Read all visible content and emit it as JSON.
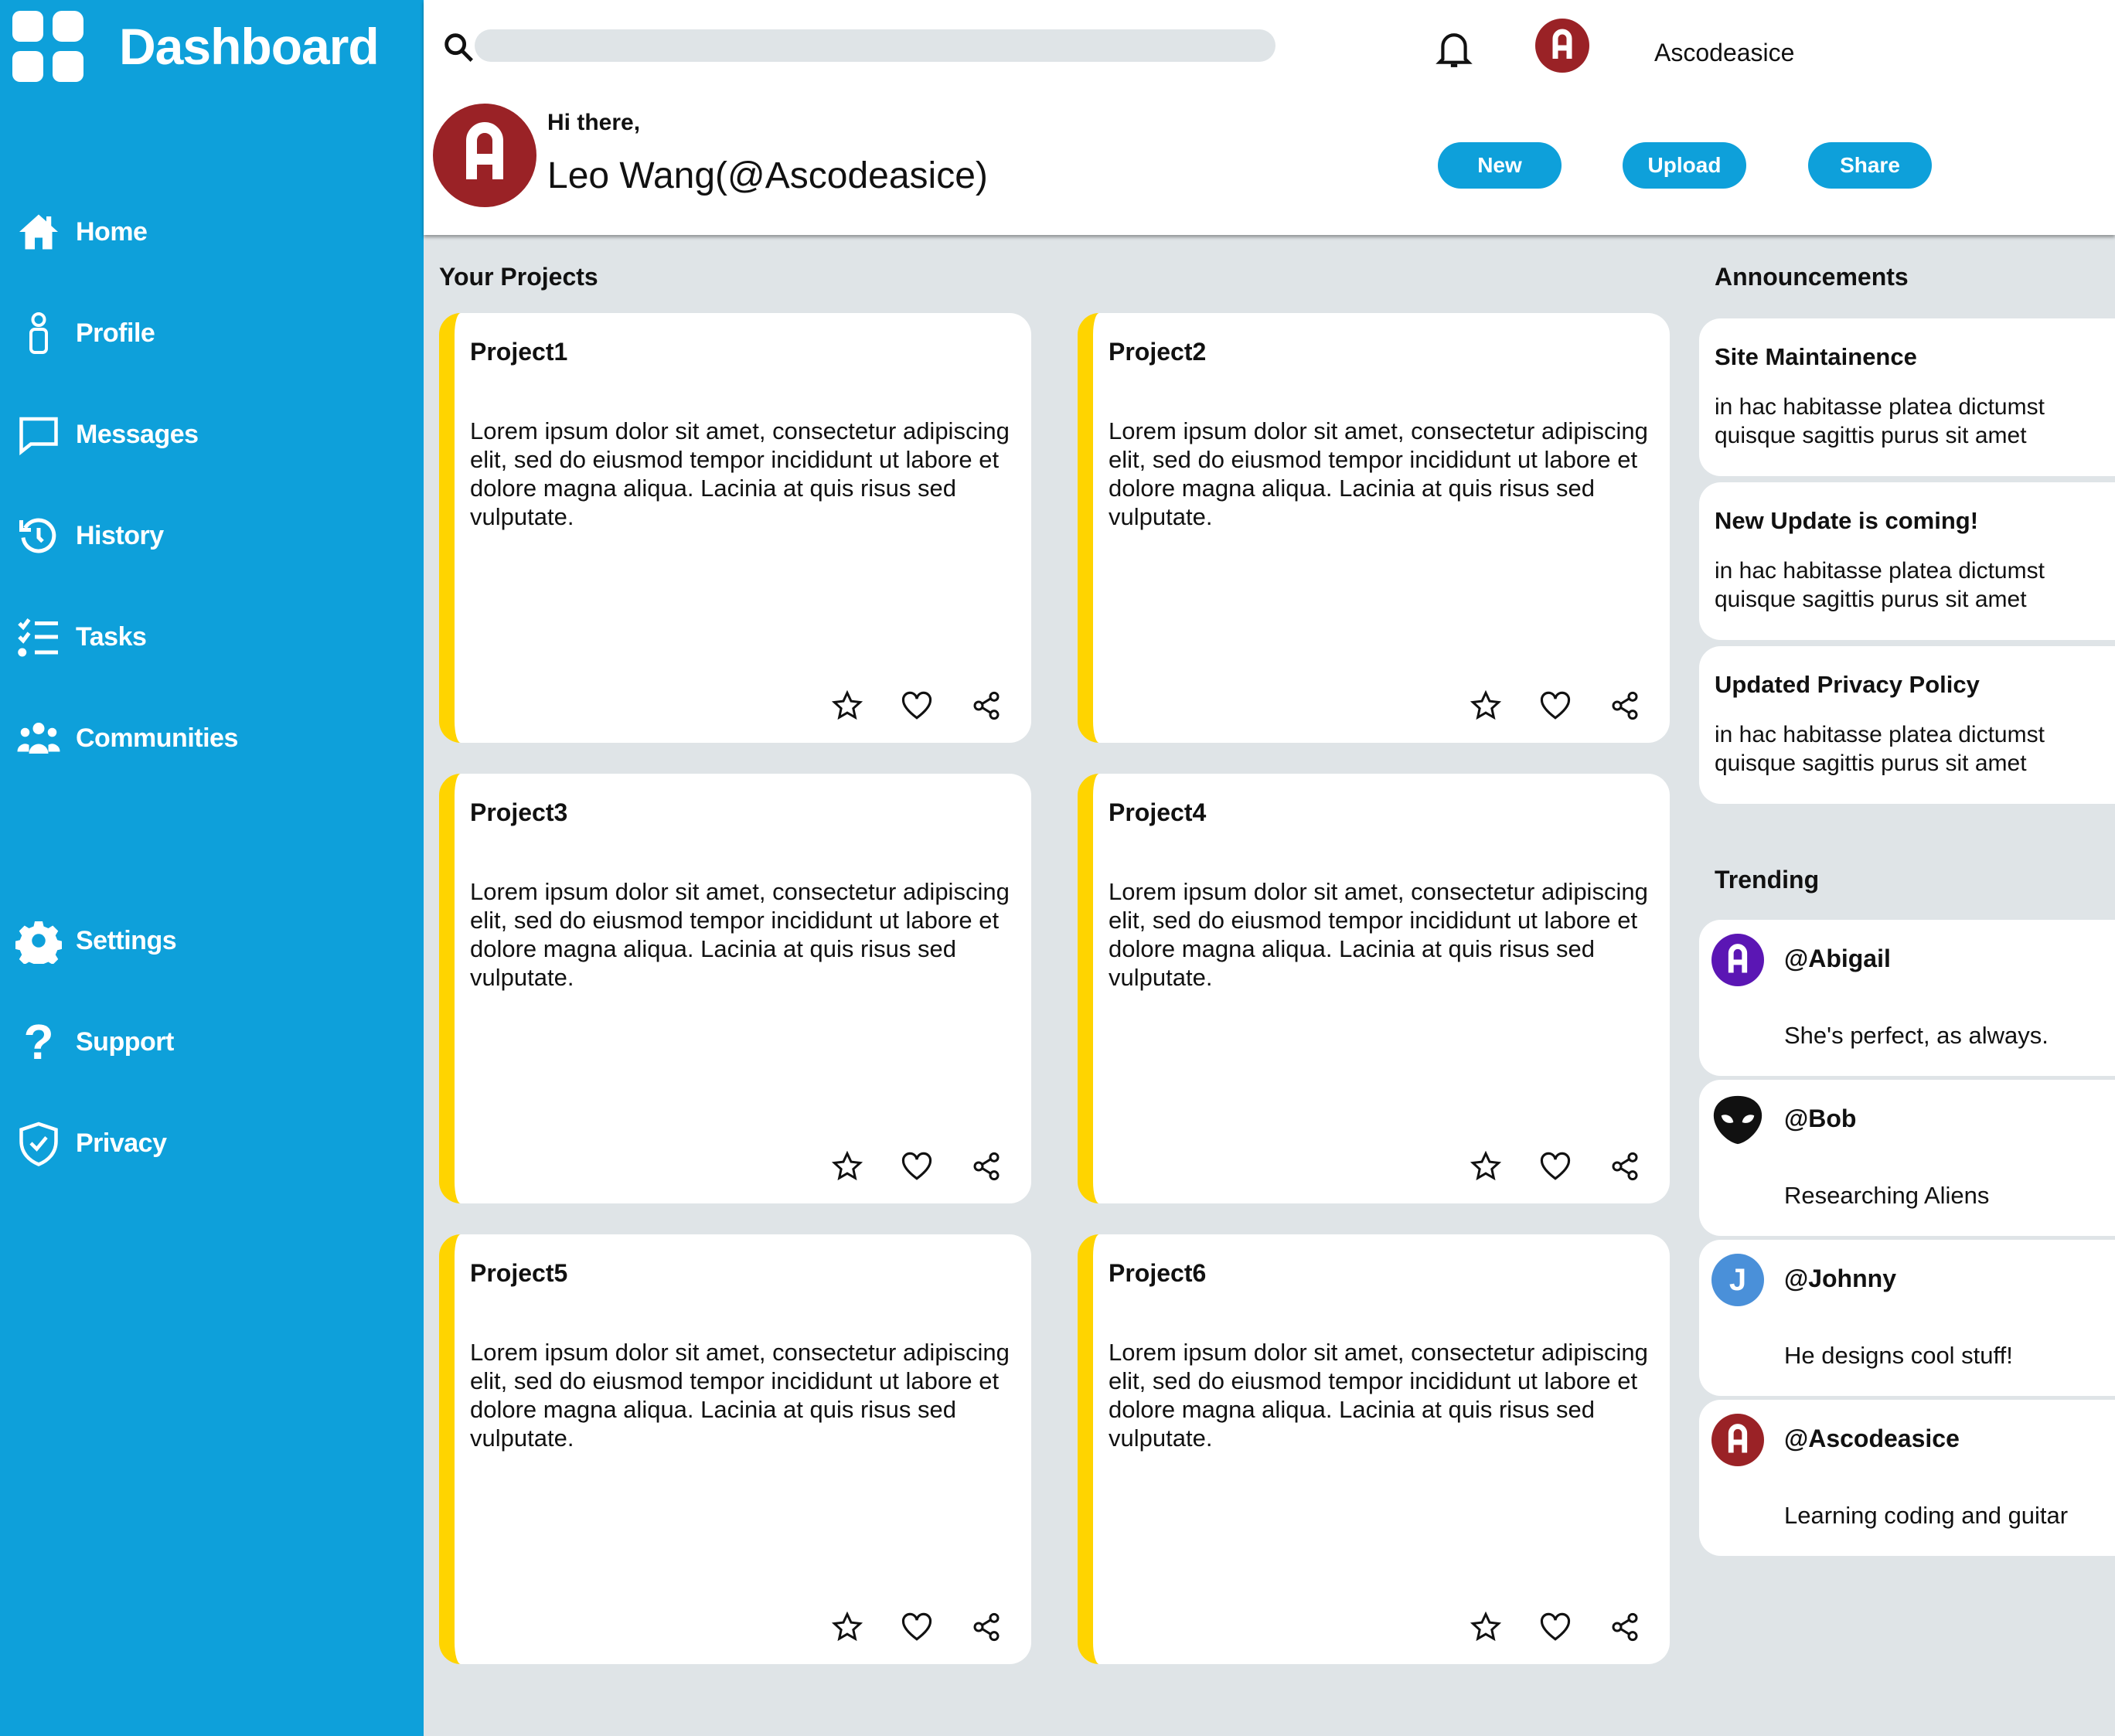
{
  "sidebar": {
    "title": "Dashboard",
    "items": [
      {
        "label": "Home",
        "icon": "home-icon"
      },
      {
        "label": "Profile",
        "icon": "person-icon"
      },
      {
        "label": "Messages",
        "icon": "chat-icon"
      },
      {
        "label": "History",
        "icon": "history-icon"
      },
      {
        "label": "Tasks",
        "icon": "checklist-icon"
      },
      {
        "label": "Communities",
        "icon": "group-icon"
      },
      {
        "label": "Settings",
        "icon": "gear-icon"
      },
      {
        "label": "Support",
        "icon": "question-icon"
      },
      {
        "label": "Privacy",
        "icon": "shield-check-icon"
      }
    ]
  },
  "header": {
    "search_placeholder": "",
    "username": "Ascodeasice",
    "greeting": "Hi there,",
    "full_name": "Leo Wang(@Ascodeasice)",
    "buttons": {
      "new": "New",
      "upload": "Upload",
      "share": "Share"
    }
  },
  "projects": {
    "title": "Your Projects",
    "items": [
      {
        "name": "Project1",
        "description": "Lorem ipsum dolor sit amet, consectetur adipiscing elit, sed do eiusmod tempor incididunt ut labore et dolore magna aliqua. Lacinia at quis risus sed vulputate."
      },
      {
        "name": "Project2",
        "description": "Lorem ipsum dolor sit amet, consectetur adipiscing elit, sed do eiusmod tempor incididunt ut labore et dolore magna aliqua. Lacinia at quis risus sed vulputate."
      },
      {
        "name": "Project3",
        "description": "Lorem ipsum dolor sit amet, consectetur adipiscing elit, sed do eiusmod tempor incididunt ut labore et dolore magna aliqua. Lacinia at quis risus sed vulputate."
      },
      {
        "name": "Project4",
        "description": "Lorem ipsum dolor sit amet, consectetur adipiscing elit, sed do eiusmod tempor incididunt ut labore et dolore magna aliqua. Lacinia at quis risus sed vulputate."
      },
      {
        "name": "Project5",
        "description": "Lorem ipsum dolor sit amet, consectetur adipiscing elit, sed do eiusmod tempor incididunt ut labore et dolore magna aliqua. Lacinia at quis risus sed vulputate."
      },
      {
        "name": "Project6",
        "description": "Lorem ipsum dolor sit amet, consectetur adipiscing elit, sed do eiusmod tempor incididunt ut labore et dolore magna aliqua. Lacinia at quis risus sed vulputate."
      }
    ]
  },
  "announcements": {
    "title": "Announcements",
    "items": [
      {
        "title": "Site Maintainence",
        "body": "in hac habitasse platea dictumst quisque sagittis purus sit amet"
      },
      {
        "title": "New Update is coming!",
        "body": "in hac habitasse platea dictumst quisque sagittis purus sit amet"
      },
      {
        "title": "Updated Privacy Policy",
        "body": "in hac habitasse platea dictumst quisque sagittis purus sit amet"
      }
    ]
  },
  "trending": {
    "title": "Trending",
    "items": [
      {
        "handle": "@Abigail",
        "text": "She's perfect, as always.",
        "avatar_color": "#5b16b4"
      },
      {
        "handle": "@Bob",
        "text": "Researching Aliens",
        "avatar_color": "#111111"
      },
      {
        "handle": "@Johnny",
        "text": "He designs cool stuff!",
        "avatar_color": "#4a90d9"
      },
      {
        "handle": "@Ascodeasice",
        "text": "Learning coding and guitar",
        "avatar_color": "#9a2226"
      }
    ]
  },
  "colors": {
    "accent": "#0ea0da",
    "card_stripe": "#ffd400",
    "avatar_main": "#9a2226",
    "background": "#dfe4e7"
  }
}
